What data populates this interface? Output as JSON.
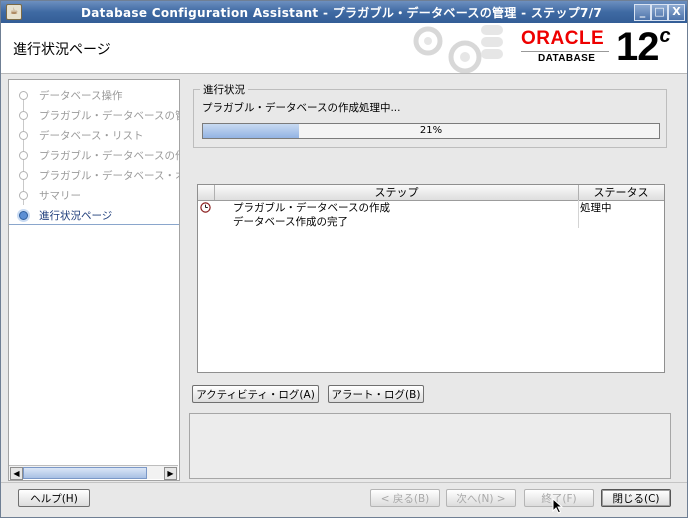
{
  "window": {
    "icon": "java-cup-icon",
    "title": "Database Configuration Assistant - プラガブル・データベースの管理 - ステップ7/7",
    "controls": {
      "minimize": "_",
      "maximize": "□",
      "close": "X"
    }
  },
  "header": {
    "page_title": "進行状況ページ",
    "logo": {
      "brand": "ORACLE",
      "product": "DATABASE",
      "version": "12",
      "version_suffix": "c"
    }
  },
  "sidebar": {
    "items": [
      {
        "label": "データベース操作",
        "state": "done"
      },
      {
        "label": "プラガブル・データベースの管",
        "state": "done"
      },
      {
        "label": "データベース・リスト",
        "state": "done"
      },
      {
        "label": "プラガブル・データベースの作",
        "state": "done"
      },
      {
        "label": "プラガブル・データベース・オ",
        "state": "done"
      },
      {
        "label": "サマリー",
        "state": "done"
      },
      {
        "label": "進行状況ページ",
        "state": "active"
      }
    ],
    "scroll_left": "◀",
    "scroll_right": "▶"
  },
  "progress": {
    "group_label": "進行状況",
    "status_text": "プラガブル・データベースの作成処理中...",
    "percent": 21,
    "percent_label": "21%"
  },
  "steps_table": {
    "columns": {
      "step": "ステップ",
      "status": "ステータス"
    },
    "rows": [
      {
        "icon": "clock-icon",
        "step": "プラガブル・データベースの作成",
        "status": "処理中"
      },
      {
        "icon": "",
        "step": "データベース作成の完了",
        "status": ""
      }
    ]
  },
  "log_buttons": {
    "activity_log": "アクティビティ・ログ(A)",
    "alert_log": "アラート・ログ(B)"
  },
  "footer": {
    "help": "ヘルプ(H)",
    "back": "< 戻る(B)",
    "next": "次へ(N) >",
    "finish": "終了(F)",
    "close": "閉じる(C)"
  },
  "colors": {
    "titlebar": "#3f6aa3",
    "oracle_red": "#ee0000",
    "progress_fill": "#93b3e3",
    "active_step": "#1d3c7a"
  }
}
